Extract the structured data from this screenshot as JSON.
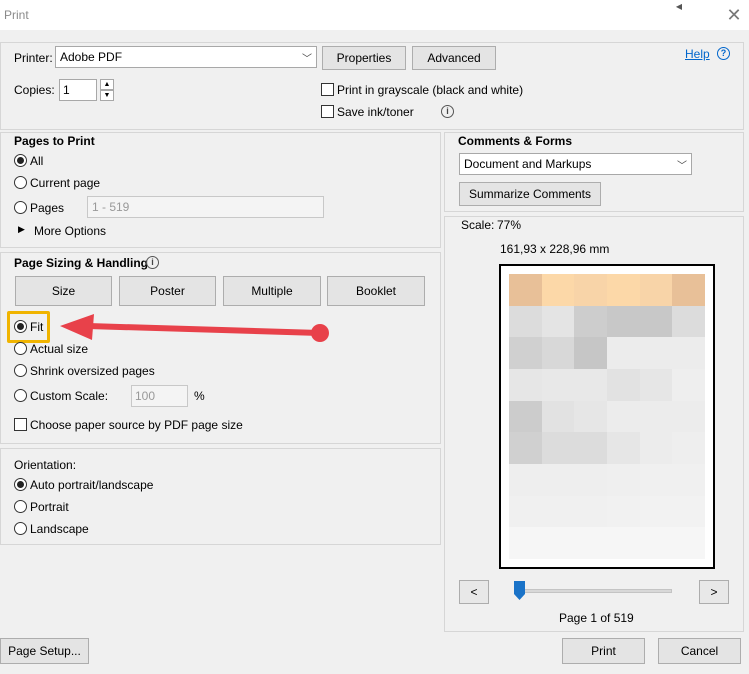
{
  "window": {
    "title": "Print",
    "close_glyph": "✕",
    "caret_glyph": "◀"
  },
  "top": {
    "printer_label": "Printer:",
    "printer_value": "Adobe PDF",
    "properties_label": "Properties",
    "advanced_label": "Advanced",
    "help_label": "Help",
    "copies_label": "Copies:",
    "copies_value": "1",
    "grayscale_label": "Print in grayscale (black and white)",
    "save_ink_label": "Save ink/toner"
  },
  "pages_to_print": {
    "title": "Pages to Print",
    "all_label": "All",
    "current_label": "Current page",
    "pages_label": "Pages",
    "pages_value": "1 - 519",
    "more_options_label": "More Options"
  },
  "sizing": {
    "title": "Page Sizing & Handling",
    "tabs": [
      "Size",
      "Poster",
      "Multiple",
      "Booklet"
    ],
    "fit_label": "Fit",
    "actual_label": "Actual size",
    "shrink_label": "Shrink oversized pages",
    "custom_label": "Custom Scale:",
    "custom_value": "100",
    "percent": "%",
    "paper_source_label": "Choose paper source by PDF page size"
  },
  "orientation": {
    "title": "Orientation:",
    "auto_label": "Auto portrait/landscape",
    "portrait_label": "Portrait",
    "landscape_label": "Landscape"
  },
  "comments": {
    "title": "Comments & Forms",
    "value": "Document and Markups",
    "summarize_label": "Summarize Comments"
  },
  "preview": {
    "scale_label": "Scale:",
    "scale_value": "77%",
    "dimensions": "161,93 x 228,96 mm",
    "prev_glyph": "<",
    "next_glyph": ">",
    "page_indicator": "Page 1 of 519",
    "slider_position": 0.0
  },
  "bottom": {
    "page_setup_label": "Page Setup...",
    "print_label": "Print",
    "cancel_label": "Cancel"
  },
  "colors": {
    "accent": "#0066cc",
    "highlight_box": "#f0b400",
    "arrow": "#e8414a",
    "slider": "#1a73c8"
  }
}
